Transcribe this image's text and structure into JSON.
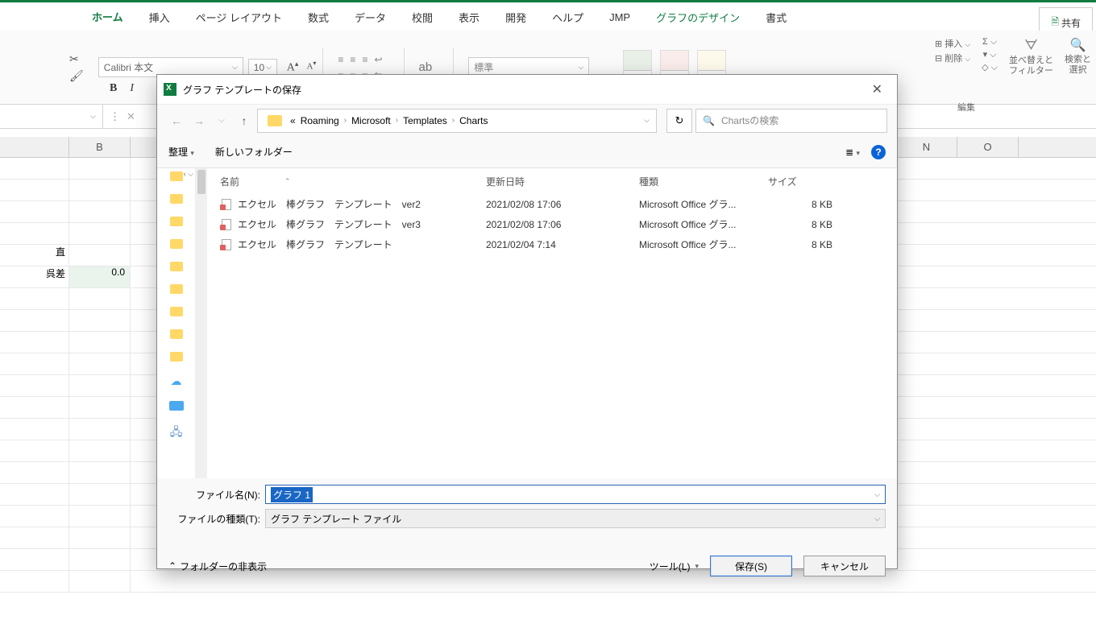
{
  "excel": {
    "tabs": [
      "ホーム",
      "挿入",
      "ページ レイアウト",
      "数式",
      "データ",
      "校閲",
      "表示",
      "開発",
      "ヘルプ",
      "JMP",
      "グラフのデザイン",
      "書式"
    ],
    "share": "共有",
    "font_name": "Calibri 本文",
    "font_size": "10",
    "number_format": "標準",
    "insert_label": "挿入",
    "delete_label": "削除",
    "sort_filter": "並べ替えと\nフィルター",
    "find_select": "検索と\n選択",
    "edit_group": "編集",
    "col_B": "B",
    "col_N": "N",
    "col_O": "O",
    "cell_b_label1": "直",
    "cell_b_label2": "呉差",
    "cell_b_value": "0.0"
  },
  "dialog": {
    "title": "グラフ テンプレートの保存",
    "breadcrumb_prefix": "«",
    "breadcrumb": [
      "Roaming",
      "Microsoft",
      "Templates",
      "Charts"
    ],
    "search_placeholder": "Chartsの検索",
    "organize": "整理",
    "new_folder": "新しいフォルダー",
    "cols": {
      "name": "名前",
      "date": "更新日時",
      "type": "種類",
      "size": "サイズ"
    },
    "files": [
      {
        "name": "エクセル　棒グラフ　テンプレート　ver2",
        "date": "2021/02/08 17:06",
        "type": "Microsoft Office グラ...",
        "size": "8 KB"
      },
      {
        "name": "エクセル　棒グラフ　テンプレート　ver3",
        "date": "2021/02/08 17:06",
        "type": "Microsoft Office グラ...",
        "size": "8 KB"
      },
      {
        "name": "エクセル　棒グラフ　テンプレート",
        "date": "2021/02/04 7:14",
        "type": "Microsoft Office グラ...",
        "size": "8 KB"
      }
    ],
    "filename_label": "ファイル名(N):",
    "filename_value": "グラフ 1",
    "filetype_label": "ファイルの種類(T):",
    "filetype_value": "グラフ テンプレート ファイル",
    "hide_folders": "フォルダーの非表示",
    "tools": "ツール(L)",
    "save": "保存(S)",
    "cancel": "キャンセル"
  }
}
